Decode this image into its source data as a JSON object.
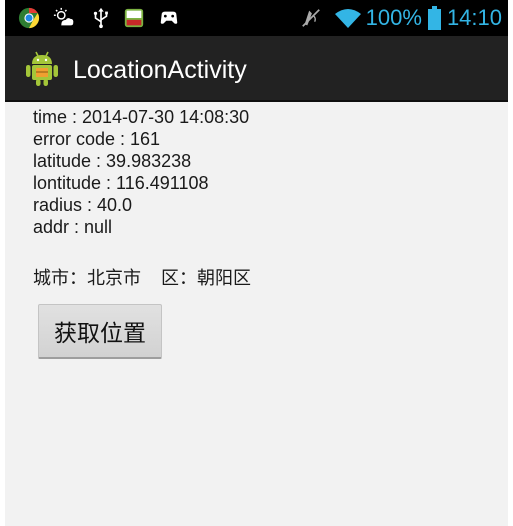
{
  "status_bar": {
    "battery": "100%",
    "time": "14:10",
    "left_icons": [
      "chrome-icon",
      "weather-icon",
      "usb-icon",
      "hao123-icon",
      "game-controller-icon"
    ],
    "right_icons": [
      "muted-icon",
      "wifi-icon",
      "battery-icon"
    ],
    "accent_color": "#33b5e5"
  },
  "action_bar": {
    "title": "LocationActivity",
    "icon": "android-icon"
  },
  "info": {
    "time": "time : 2014-07-30 14:08:30",
    "error_code": "error code : 161",
    "latitude": "latitude : 39.983238",
    "longitude": "lontitude : 116.491108",
    "radius": "radius : 40.0",
    "addr": "addr : null"
  },
  "city": {
    "city_text": "城市：北京市",
    "district_text": "区：朝阳区"
  },
  "button": {
    "label": "获取位置"
  }
}
